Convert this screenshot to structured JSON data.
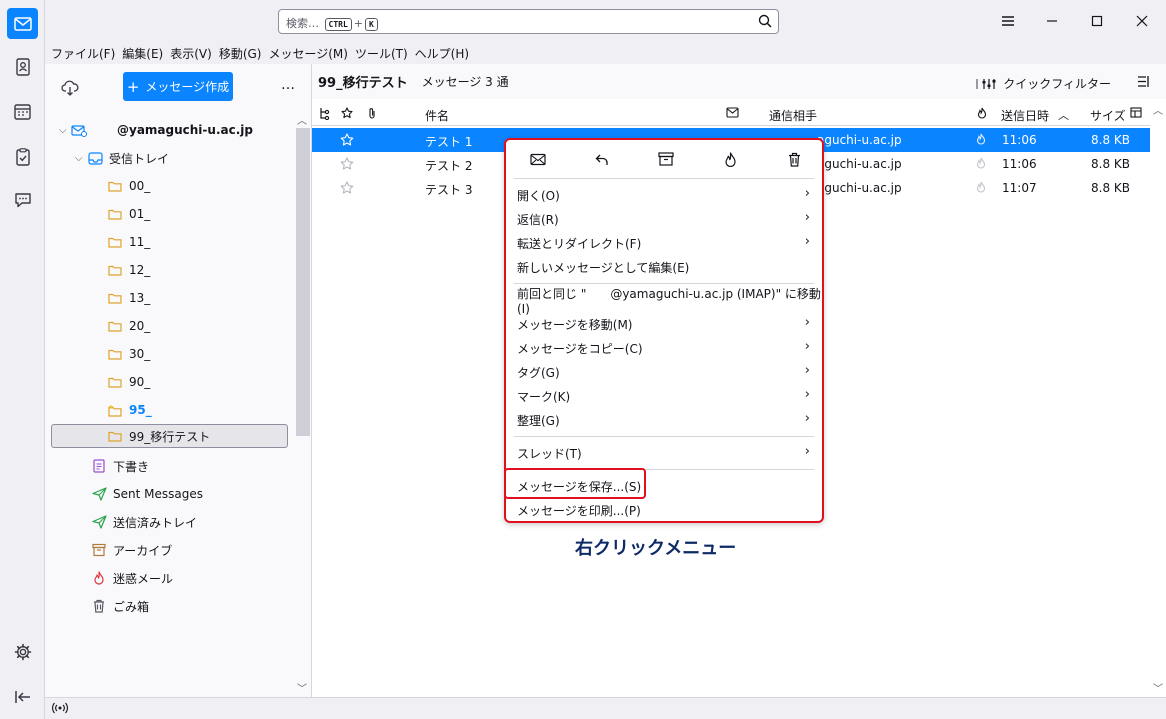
{
  "titlebar": {
    "search_placeholder": "検索…",
    "search_key1": "CTRL",
    "search_plus": "+",
    "search_key2": "K"
  },
  "menubar": {
    "items": [
      "ファイル(F)",
      "編集(E)",
      "表示(V)",
      "移動(G)",
      "メッセージ(M)",
      "ツール(T)",
      "ヘルプ(H)"
    ]
  },
  "folder_pane": {
    "compose_label": "メッセージ作成",
    "more_label": "…",
    "account": "@yamaguchi-u.ac.jp",
    "inbox": "受信トレイ",
    "folders": [
      "00_",
      "01_",
      "11_",
      "12_",
      "13_",
      "20_",
      "30_",
      "90_",
      "95_",
      "99_移行テスト"
    ],
    "special": [
      "下書き",
      "Sent Messages",
      "送信済みトレイ",
      "アーカイブ",
      "迷惑メール",
      "ごみ箱"
    ]
  },
  "thread_pane": {
    "folder_name": "99_移行テスト",
    "count": "メッセージ 3 通",
    "quick_filter": "クイックフィルター",
    "columns": {
      "subject": "件名",
      "correspondent": "通信相手",
      "date": "送信日時",
      "size": "サイズ"
    },
    "rows": [
      {
        "subject": "テスト 1",
        "from": "aguchi-u.ac.jp",
        "date": "11:06",
        "size": "8.8 KB"
      },
      {
        "subject": "テスト 2",
        "from": "aguchi-u.ac.jp",
        "date": "11:06",
        "size": "8.8 KB"
      },
      {
        "subject": "テスト 3",
        "from": "aguchi-u.ac.jp",
        "date": "11:07",
        "size": "8.8 KB"
      }
    ]
  },
  "context_menu": {
    "items": [
      {
        "label": "開く(O)",
        "submenu": true
      },
      {
        "label": "返信(R)",
        "submenu": true
      },
      {
        "label": "転送とリダイレクト(F)",
        "submenu": true
      },
      {
        "label": "新しいメッセージとして編集(E)",
        "submenu": false
      },
      {
        "label": "前回と同じ \"　　@yamaguchi-u.ac.jp (IMAP)\" に移動(I)",
        "submenu": false
      },
      {
        "label": "メッセージを移動(M)",
        "submenu": true
      },
      {
        "label": "メッセージをコピー(C)",
        "submenu": true
      },
      {
        "label": "タグ(G)",
        "submenu": true
      },
      {
        "label": "マーク(K)",
        "submenu": true
      },
      {
        "label": "整理(G)",
        "submenu": true
      },
      {
        "label": "スレッド(T)",
        "submenu": true
      },
      {
        "label": "メッセージを保存...(S)",
        "submenu": false
      },
      {
        "label": "メッセージを印刷...(P)",
        "submenu": false
      }
    ],
    "submenu_arrow": "›"
  },
  "annotation": {
    "caption": "右クリックメニュー"
  },
  "colors": {
    "accent": "#0a84ff",
    "highlight_border": "#e0101e",
    "caption": "#0e2a66",
    "folder_icon": "#e0a32a"
  }
}
